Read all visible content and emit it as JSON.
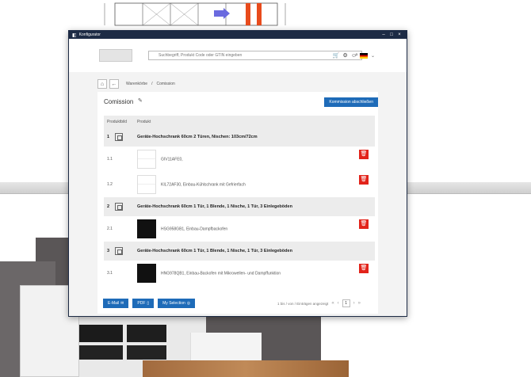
{
  "window": {
    "title": "Konfigurator",
    "controls": [
      "–",
      "□",
      "×"
    ]
  },
  "header": {
    "search_placeholder": "Suchbegriff, Produkt Code oder GTIN eingeben"
  },
  "breadcrumb": {
    "home": "⌂",
    "back": "←",
    "cart": "Warenkörbe",
    "separator": "/",
    "current": "Comission"
  },
  "card": {
    "title": "Comission",
    "close_button": "Kommission abschließen",
    "columns": [
      "Produktbild",
      "Produkt"
    ]
  },
  "groups": [
    {
      "index": "1",
      "title": "Geräte-Hochschrank 60cm 2 Türen, Nischen: 103cm/72cm",
      "items": [
        {
          "num": "1.1",
          "text": "GIV11AFE0,",
          "thumb": "fridge"
        },
        {
          "num": "1.2",
          "text": "KIL72AF30, Einbau-Kühlschrank mit Gefrierfach",
          "thumb": "fridge"
        }
      ]
    },
    {
      "index": "2",
      "title": "Geräte-Hochschrank 60cm 1 Tür, 1 Blende, 1 Nische, 1 Tür, 3 Einlegeböden",
      "items": [
        {
          "num": "2.1",
          "text": "HSG958GB1, Einbau-Dampfbackofen",
          "thumb": "oven"
        }
      ]
    },
    {
      "index": "3",
      "title": "Geräte-Hochschrank 60cm 1 Tür, 1 Blende, 1 Nische, 1 Tür, 3 Einlegeböden",
      "items": [
        {
          "num": "3.1",
          "text": "HNG978QB1, Einbau-Backofen mit Mikrowellen- und Dampffunktion",
          "thumb": "oven"
        }
      ]
    }
  ],
  "footer": {
    "email": "E-Mail",
    "pdf": "PDF",
    "selection": "My Selection",
    "pager_text": "1 bis / von / Einträgen angezeigt",
    "page": "1"
  }
}
